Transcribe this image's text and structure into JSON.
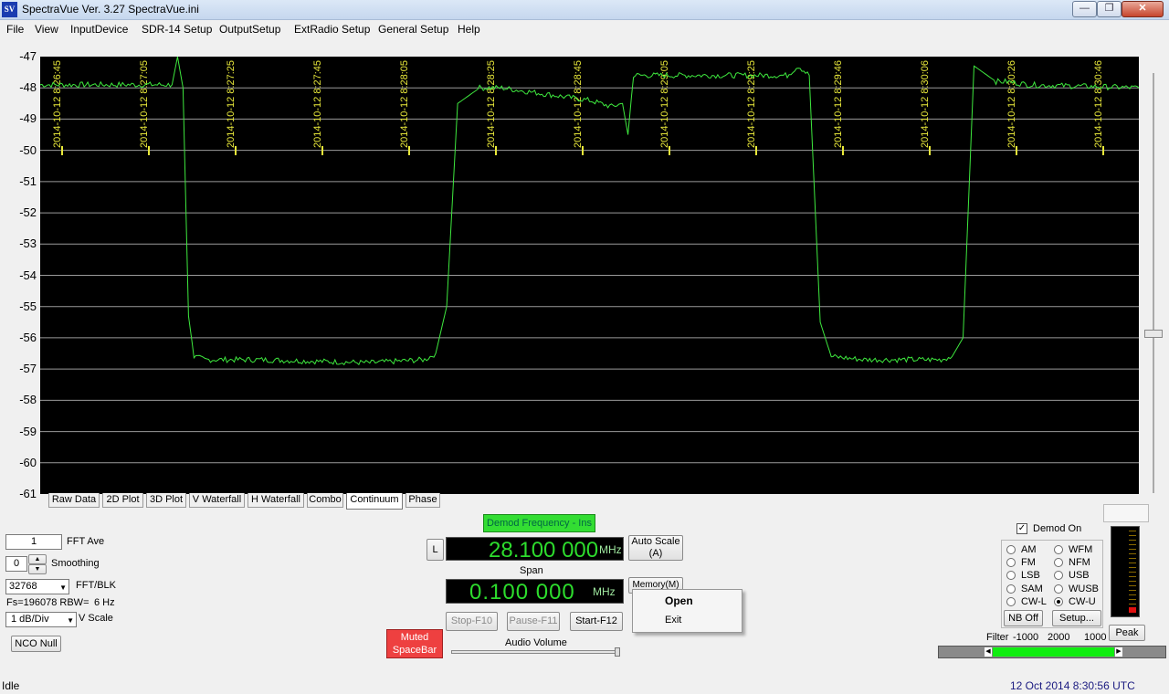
{
  "window": {
    "title": "SpectraVue Ver. 3.27  SpectraVue.ini",
    "icon_text": "SV",
    "min": "0",
    "max": "1",
    "close": "r"
  },
  "menu": [
    "File",
    "View",
    "InputDevice",
    "SDR-14 Setup",
    "OutputSetup",
    "ExtRadio Setup",
    "General Setup",
    "Help"
  ],
  "chart_data": {
    "type": "line",
    "y_axis": {
      "min": -61,
      "max": -47,
      "ticks": [
        "-47",
        "-48",
        "-49",
        "-50",
        "-51",
        "-52",
        "-53",
        "-54",
        "-55",
        "-56",
        "-57",
        "-58",
        "-59",
        "-60",
        "-61"
      ]
    },
    "x_time_labels": [
      "2014-10-12 8:26:45",
      "2014-10-12 8:27:05",
      "2014-10-12 8:27:25",
      "2014-10-12 8:27:45",
      "2014-10-12 8:28:05",
      "2014-10-12 8:28:25",
      "2014-10-12 8:28:45",
      "2014-10-12 8:29:05",
      "2014-10-12 8:29:25",
      "2014-10-12 8:29:46",
      "2014-10-12 8:30:06",
      "2014-10-12 8:30:26",
      "2014-10-12 8:30:46"
    ],
    "grid": true,
    "trace_color": "#3ee83e",
    "series": [
      {
        "x": [
          0,
          0.08,
          0.12,
          0.125,
          0.13,
          0.135,
          0.14,
          0.15,
          0.2,
          0.3,
          0.35,
          0.36,
          0.37,
          0.38,
          0.4,
          0.42,
          0.44,
          0.46,
          0.48,
          0.5,
          0.52,
          0.53,
          0.535,
          0.54,
          0.55,
          0.6,
          0.65,
          0.68,
          0.69,
          0.7,
          0.71,
          0.72,
          0.75,
          0.8,
          0.82,
          0.83,
          0.84,
          0.85,
          0.87,
          0.88,
          0.9,
          1.0
        ],
        "y": [
          -47.9,
          -47.9,
          -47.9,
          -47.0,
          -48.0,
          -55.3,
          -56.6,
          -56.7,
          -56.7,
          -56.8,
          -56.7,
          -56.5,
          -55.0,
          -48.5,
          -48.0,
          -48.0,
          -48.1,
          -48.2,
          -48.3,
          -48.4,
          -48.6,
          -48.5,
          -49.5,
          -47.6,
          -47.6,
          -47.6,
          -47.6,
          -47.6,
          -47.3,
          -47.6,
          -55.5,
          -56.6,
          -56.7,
          -56.7,
          -56.7,
          -56.6,
          -56.0,
          -47.3,
          -47.8,
          -47.8,
          -47.9,
          -48.0
        ]
      }
    ]
  },
  "tabs": [
    "Raw Data",
    "2D Plot",
    "3D Plot",
    "V Waterfall",
    "H Waterfall",
    "Combo",
    "Continuum",
    "Phase"
  ],
  "active_tab": "Continuum",
  "controls": {
    "fft_ave_value": "1",
    "fft_ave_label": "FFT Ave",
    "smoothing_value": "0",
    "smoothing_label": "Smoothing",
    "fft_blk_value": "32768",
    "fft_blk_label": "FFT/BLK",
    "fs_rbw": "Fs=196078 RBW=",
    "rbw_value": "6 Hz",
    "vscale_value": "1 dB/Div",
    "vscale_label": "V Scale",
    "nco_null": "NCO Null"
  },
  "center": {
    "demod_button": "Demod Frequency - Ins",
    "l_button": "L",
    "freq_value": "28.100 000",
    "freq_unit": "MHz",
    "auto_scale": "Auto Scale",
    "auto_scale_key": "(A)",
    "span_label": "Span",
    "span_value": "0.100 000",
    "span_unit": "MHz",
    "memory": "Memory(M)",
    "muted_line1": "Muted",
    "muted_line2": "SpaceBar",
    "stop": "Stop-F10",
    "pause": "Pause-F11",
    "start": "Start-F12",
    "audio_volume": "Audio Volume"
  },
  "context_menu": [
    "Open",
    "Exit"
  ],
  "demod": {
    "demod_on": "Demod On",
    "modes": [
      "AM",
      "WFM",
      "FM",
      "NFM",
      "LSB",
      "USB",
      "SAM",
      "WUSB",
      "CW-L",
      "CW-U"
    ],
    "selected": "CW-U",
    "nb_off": "NB Off",
    "setup": "Setup...",
    "peak": "Peak",
    "filter_label": "Filter",
    "filter_low": "-1000",
    "filter_mid": "2000",
    "filter_high": "1000"
  },
  "status": {
    "left": "Idle",
    "right": "12 Oct 2014  8:30:56 UTC"
  }
}
